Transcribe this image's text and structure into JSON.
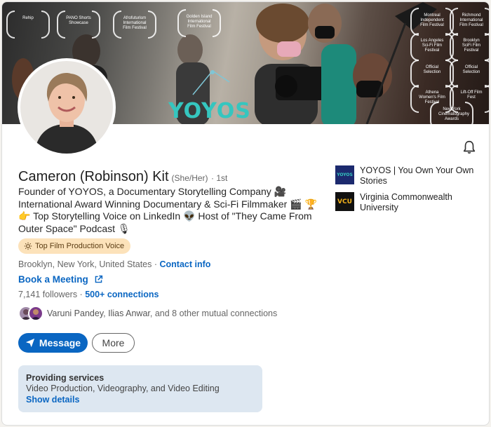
{
  "banner": {
    "brand_text": "YOYOS",
    "awards": [
      "Rehip",
      "PANO Shorts Showcase",
      "Afrofuturism International Film Festival",
      "Golden Island International Film Festival",
      "Montreal Independent Film Festival",
      "Richmond International Film Festival",
      "Los Angeles Sci-Fi Film Festival",
      "Brooklyn SciFi Film Festival",
      "Official Selection",
      "Official Selection",
      "Athena Women's Film Festival",
      "Lift-Off Film Fest",
      "New York Cinematography Awards"
    ]
  },
  "profile": {
    "name": "Cameron (Robinson) Kit",
    "pronouns": "(She/Her)",
    "degree": "· 1st",
    "headline": "Founder of YOYOS, a Documentary Storytelling Company 🎥 International Award Winning Documentary & Sci-Fi Filmmaker 🎬 🏆 👉 Top Storytelling Voice on LinkedIn 👽 Host of \"They Came From Outer Space\" Podcast 🎙",
    "badge": "Top Film Production Voice",
    "location": "Brooklyn, New York, United States",
    "location_sep": " · ",
    "contact_info": "Contact info",
    "book_meeting": "Book a Meeting",
    "followers": "7,141 followers",
    "followers_sep": " · ",
    "connections": "500+ connections",
    "mutual": {
      "name1": "Varuni Pandey",
      "sep": ", ",
      "name2": "Ilias Anwar",
      "rest": ", and 8 other mutual connections"
    }
  },
  "actions": {
    "message": "Message",
    "more": "More"
  },
  "services": {
    "title": "Providing services",
    "description": "Video Production, Videography, and Video Editing",
    "show_details": "Show details"
  },
  "organizations": [
    {
      "name": "YOYOS | You Own Your Own Stories",
      "logo_text": "YOYOS"
    },
    {
      "name": "Virginia Commonwealth University",
      "logo_text": "VCU"
    }
  ],
  "icons": {
    "bell": "bell-icon",
    "send": "send-icon",
    "external": "external-link-icon",
    "sun": "sun-icon"
  },
  "colors": {
    "accent": "#0a66c2",
    "badge_bg": "#fce2ba",
    "services_bg": "#dde7f1",
    "brand_teal": "#35c6bf"
  }
}
